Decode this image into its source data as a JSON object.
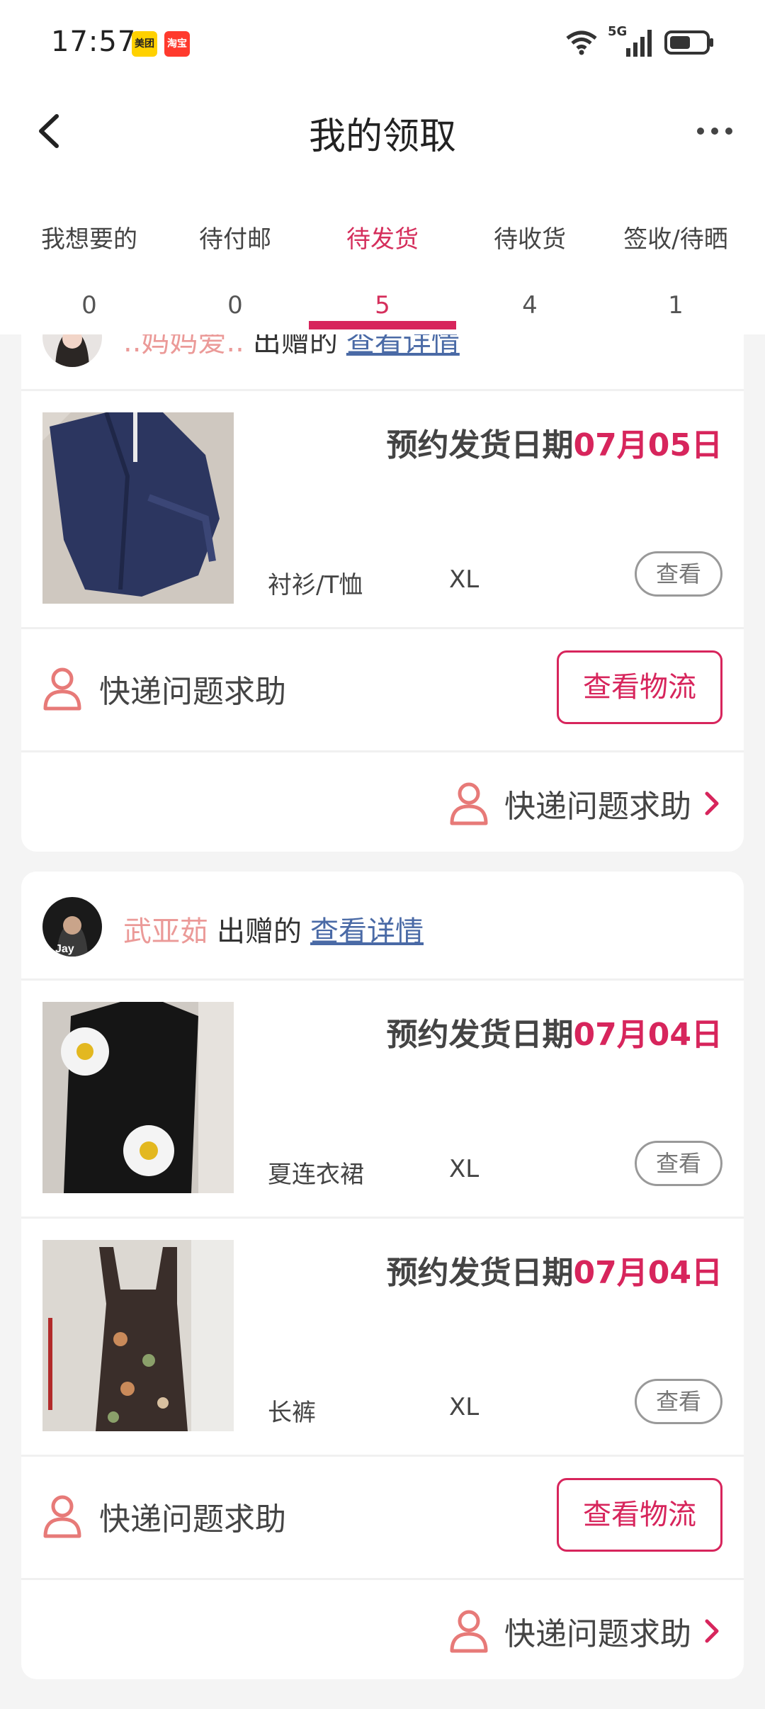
{
  "status_bar": {
    "time": "17:57",
    "app_badges": [
      "美团",
      "淘宝"
    ],
    "network": "5G"
  },
  "nav": {
    "title": "我的领取"
  },
  "tabs": [
    {
      "label": "我想要的",
      "count": "0",
      "active": false
    },
    {
      "label": "待付邮",
      "count": "0",
      "active": false
    },
    {
      "label": "待发货",
      "count": "5",
      "active": true
    },
    {
      "label": "待收货",
      "count": "4",
      "active": false
    },
    {
      "label": "签收/待晒",
      "count": "1",
      "active": false
    }
  ],
  "cards": [
    {
      "donor": {
        "name": "..妈妈爱..",
        "verb": "出赠的",
        "link": "查看详情"
      },
      "items": [
        {
          "date_prefix": "预约发货日期",
          "date": "07月05日",
          "category": "衬衫/T恤",
          "size": "XL",
          "view": "查看"
        }
      ],
      "help": {
        "label": "快递问题求助",
        "logistics": "查看物流"
      },
      "footer_help": "快递问题求助"
    },
    {
      "donor": {
        "name": "武亚茹",
        "verb": "出赠的",
        "link": "查看详情"
      },
      "items": [
        {
          "date_prefix": "预约发货日期",
          "date": "07月04日",
          "category": "夏连衣裙",
          "size": "XL",
          "view": "查看"
        },
        {
          "date_prefix": "预约发货日期",
          "date": "07月04日",
          "category": "长裤",
          "size": "XL",
          "view": "查看"
        }
      ],
      "help": {
        "label": "快递问题求助",
        "logistics": "查看物流"
      },
      "footer_help": "快递问题求助"
    }
  ],
  "colors": {
    "accent": "#d7255c",
    "donor_name": "#eb9a98",
    "link": "#4a6aa6"
  }
}
